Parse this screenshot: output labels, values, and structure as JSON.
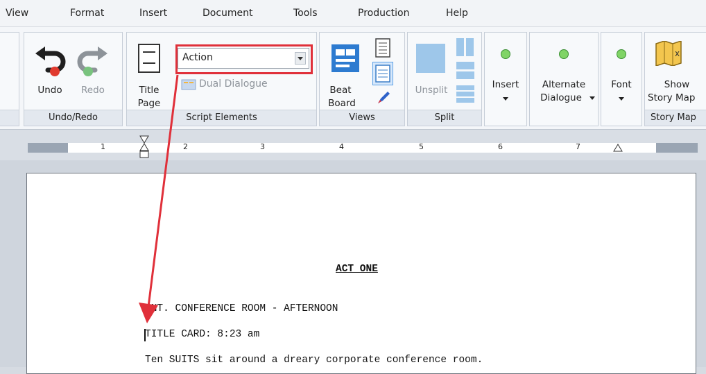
{
  "menu": [
    "View",
    "Format",
    "Insert",
    "Document",
    "Tools",
    "Production",
    "Help"
  ],
  "ribbon": {
    "undo_label": "Undo",
    "redo_label": "Redo",
    "undo_group": "Undo/Redo",
    "title_page": [
      "Title",
      "Page"
    ],
    "element_select": "Action",
    "dual_dialogue": "Dual Dialogue",
    "script_elements_group": "Script Elements",
    "beat_board": [
      "Beat",
      "Board"
    ],
    "views_group": "Views",
    "unsplit": "Unsplit",
    "split_group": "Split",
    "insert": "Insert",
    "alternate_dialogue": [
      "Alternate",
      "Dialogue"
    ],
    "font": "Font",
    "story_map": [
      "Show",
      "Story Map"
    ],
    "story_map_group": "Story Map"
  },
  "ruler": {
    "numbers": [
      "1",
      "2",
      "3",
      "4",
      "5",
      "6",
      "7"
    ]
  },
  "document": {
    "heading": "ACT ONE",
    "scene_heading": "INT. CONFERENCE ROOM - AFTERNOON",
    "title_card": "TITLE CARD: 8:23 am",
    "action": "Ten SUITS sit around a dreary corporate conference room."
  },
  "colors": {
    "highlight": "#e0303a",
    "accent_blue": "#2f7ed2"
  }
}
